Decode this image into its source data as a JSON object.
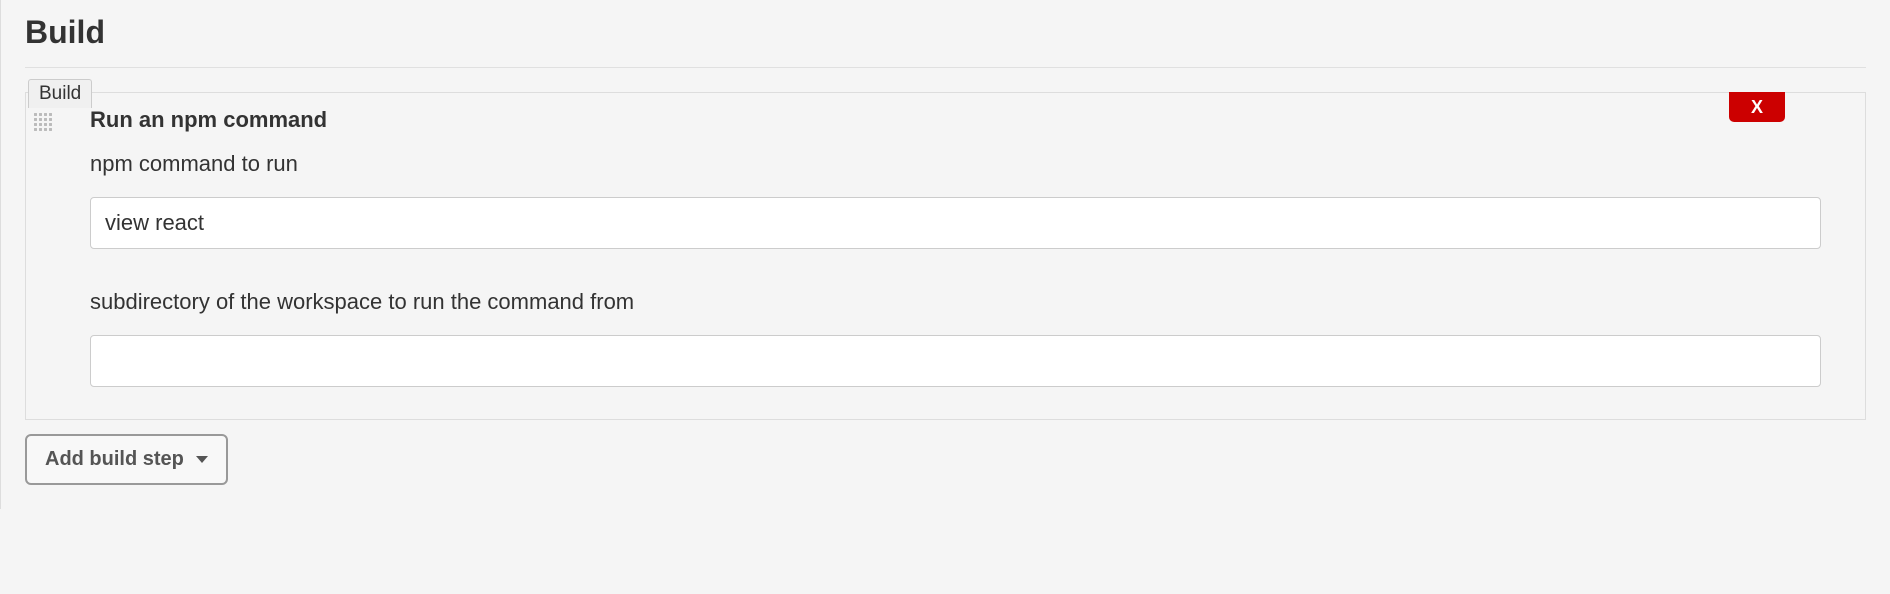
{
  "section": {
    "title": "Build"
  },
  "step": {
    "tag": "Build",
    "title": "Run an npm command",
    "delete_label": "X",
    "fields": {
      "command": {
        "label": "npm command to run",
        "value": "view react"
      },
      "subdirectory": {
        "label": "subdirectory of the workspace to run the command from",
        "value": ""
      }
    }
  },
  "actions": {
    "add_step": "Add build step"
  }
}
